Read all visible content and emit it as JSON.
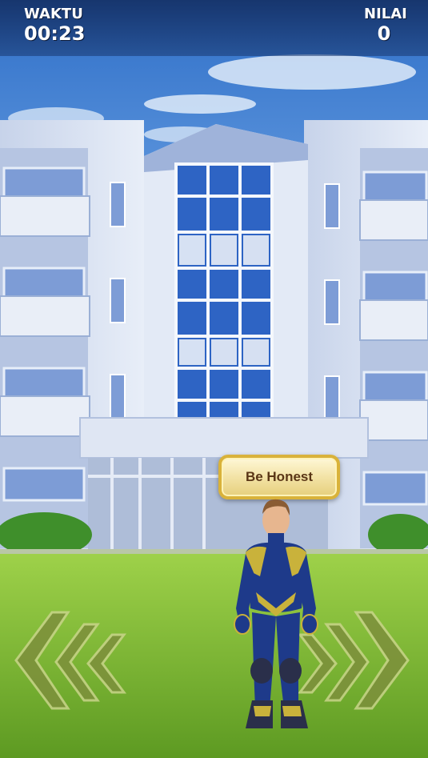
{
  "hud": {
    "time_label": "WAKTU",
    "time_value": "00:23",
    "score_label": "NILAI",
    "score_value": "0"
  },
  "action_button": {
    "label": "Be Honest"
  },
  "controls": {
    "left_icon": "chevron-left-triple-icon",
    "right_icon": "chevron-right-triple-icon"
  },
  "colors": {
    "hud": "#17366e",
    "button_border": "#d9b23a",
    "button_text": "#5a3616",
    "grass": "#7fbe2e",
    "arrow": "#7d8f3c"
  }
}
